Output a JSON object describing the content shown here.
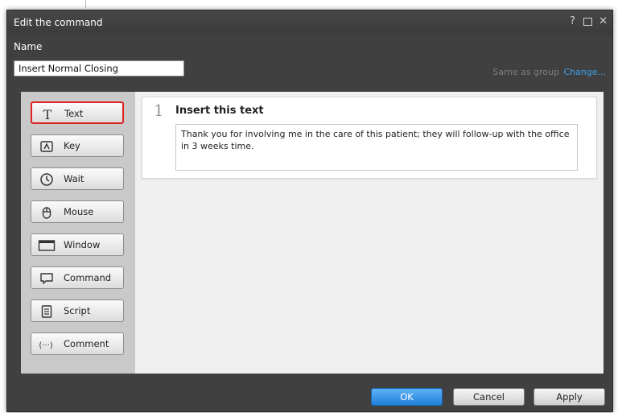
{
  "dialog": {
    "title": "Edit the command",
    "controls": {
      "help": "?",
      "close": "✕"
    }
  },
  "name": {
    "label": "Name",
    "value": "Insert Normal Closing",
    "same_as_group": "Same as group",
    "change_link": "Change..."
  },
  "tools": [
    {
      "label": "Text",
      "icon": "text-icon",
      "selected": true
    },
    {
      "label": "Key",
      "icon": "key-icon",
      "selected": false
    },
    {
      "label": "Wait",
      "icon": "clock-icon",
      "selected": false
    },
    {
      "label": "Mouse",
      "icon": "mouse-icon",
      "selected": false
    },
    {
      "label": "Window",
      "icon": "window-icon",
      "selected": false
    },
    {
      "label": "Command",
      "icon": "speech-bubble-icon",
      "selected": false
    },
    {
      "label": "Script",
      "icon": "script-icon",
      "selected": false
    },
    {
      "label": "Comment",
      "icon": "ellipsis-icon",
      "selected": false
    }
  ],
  "steps": [
    {
      "number": "1",
      "title": "Insert this text",
      "text": "Thank you for involving me in the care of this patient; they will follow-up with the office in 3 weeks time."
    }
  ],
  "buttons": {
    "ok": "OK",
    "cancel": "Cancel",
    "apply": "Apply"
  },
  "colors": {
    "dialog_bg": "#404040",
    "accent_blue": "#2b8ae6",
    "selection_red": "#dd2222",
    "link_blue": "#3b9fe8"
  }
}
